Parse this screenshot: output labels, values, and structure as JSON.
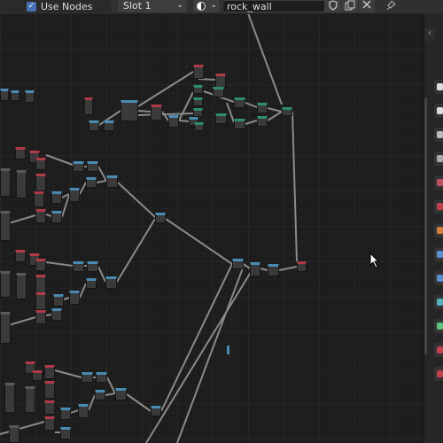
{
  "header": {
    "use_nodes_label": "Use Nodes",
    "use_nodes_checked": true,
    "slot_label": "Slot 1",
    "material_name": "rock_wall"
  },
  "icons": {
    "checkbox": "checkmark-icon",
    "slot_dropdown": "chevron-down-icon",
    "material_preview": "material-sphere-icon",
    "fake_user": "shield-icon",
    "duplicate": "copy-icon",
    "unlink": "close-icon",
    "pin": "pin-icon",
    "cursor": "mouse-pointer-icon"
  },
  "colors": {
    "background": "#1d1d1d",
    "node_body": "#3a3a3a",
    "header_blue": "#4a8bb3",
    "header_red": "#b03a48",
    "header_green": "#2d8f68",
    "link": "#8a8a8a",
    "accent": "#4772b3"
  },
  "sidebar": {
    "tabs": [
      {
        "name": "tool-tab",
        "color": "#dddddd"
      },
      {
        "name": "render-tab",
        "color": "#dddddd"
      },
      {
        "name": "output-tab",
        "color": "#bbbbbb"
      },
      {
        "name": "view-layer-tab",
        "color": "#aaaaaa"
      },
      {
        "name": "scene-tab",
        "color": "#c05060"
      },
      {
        "name": "world-tab",
        "color": "#c04050"
      },
      {
        "name": "object-tab",
        "color": "#d08040"
      },
      {
        "name": "modifier-tab",
        "color": "#5a8fd0"
      },
      {
        "name": "particles-tab",
        "color": "#5a8fd0"
      },
      {
        "name": "physics-tab",
        "color": "#5ab0c0"
      },
      {
        "name": "constraints-tab",
        "color": "#60c080"
      },
      {
        "name": "data-tab",
        "color": "#c04050"
      },
      {
        "name": "material-tab",
        "color": "#c04050"
      }
    ]
  }
}
